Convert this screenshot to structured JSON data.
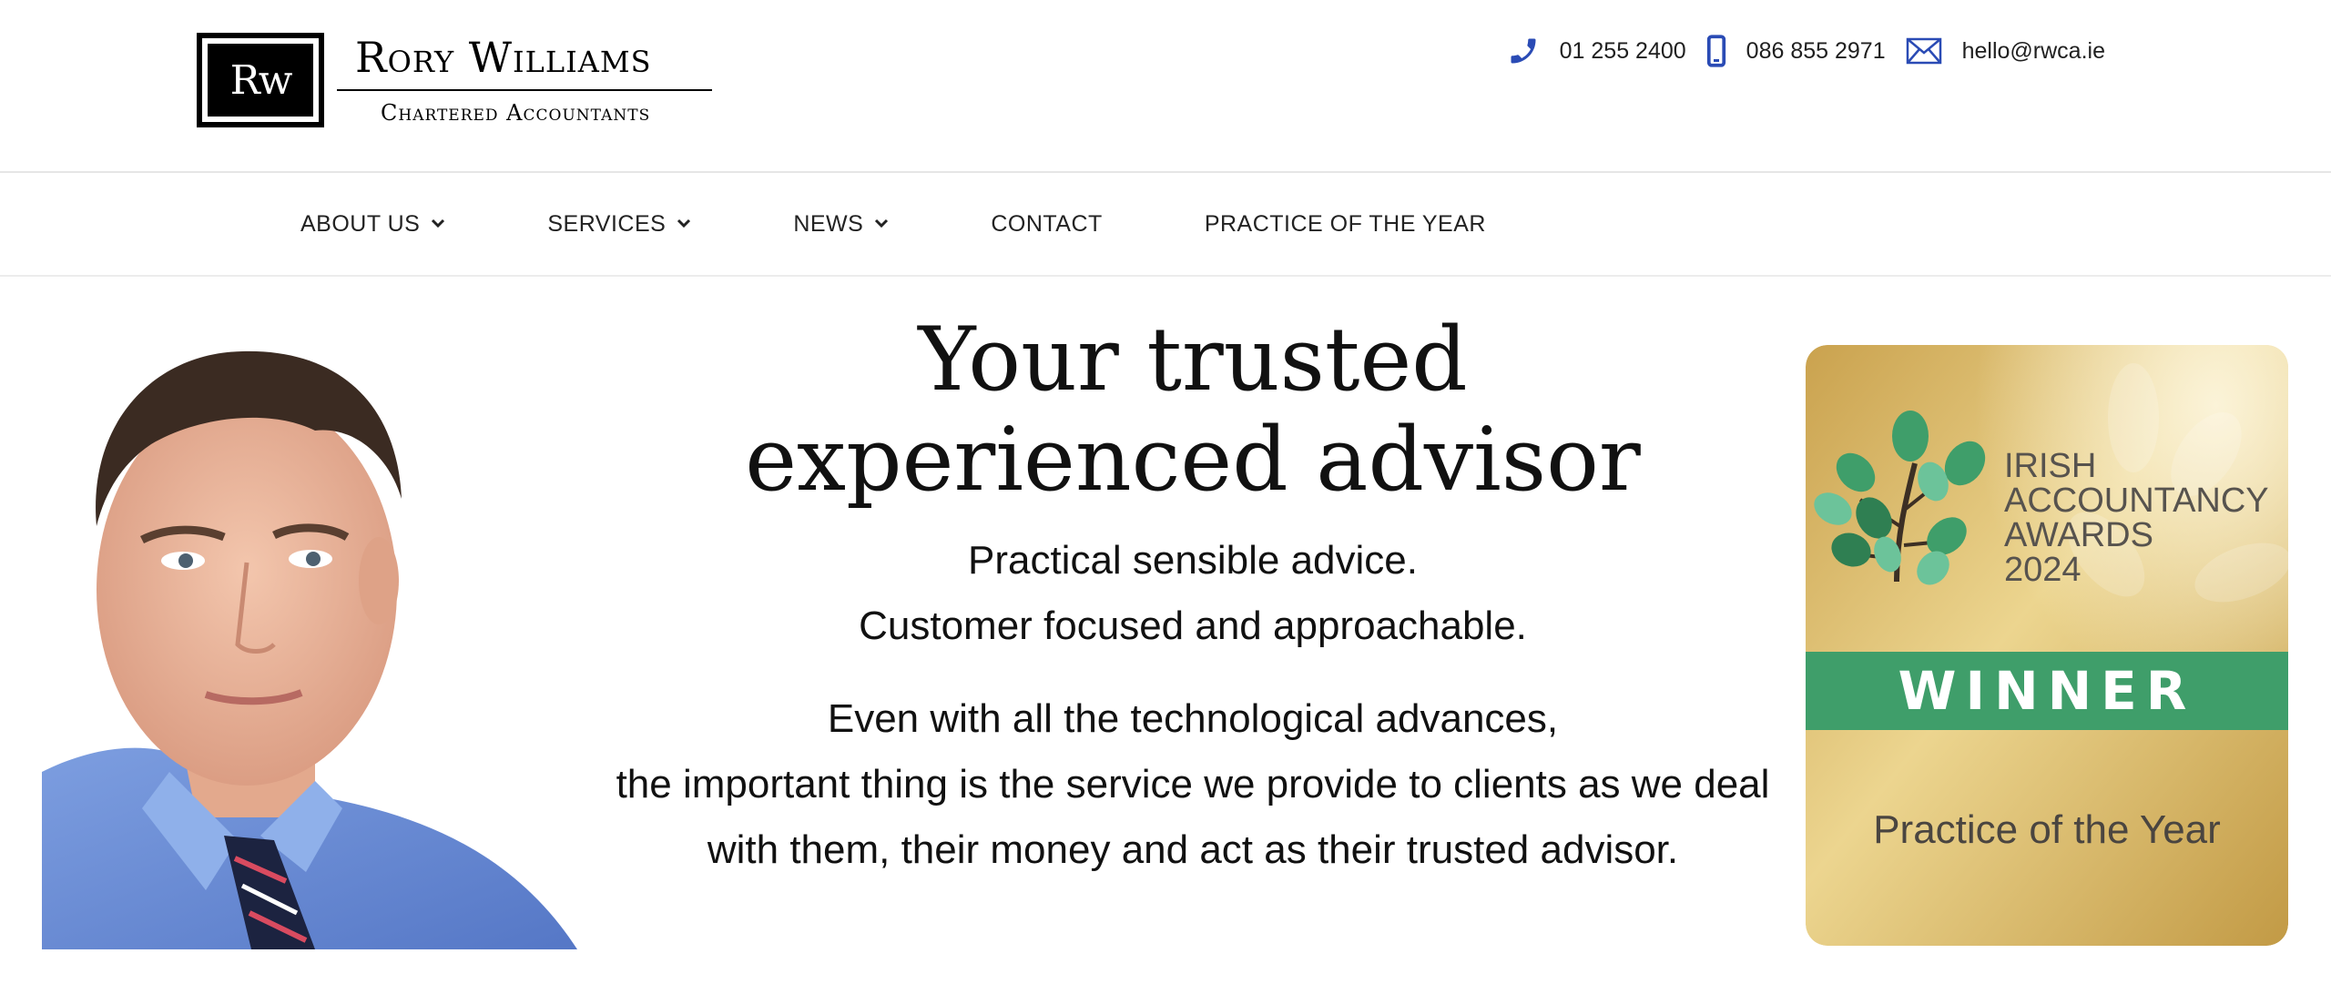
{
  "brand": {
    "monogram": "Rw",
    "name": "Rory Williams",
    "subtitle": "Chartered Accountants"
  },
  "contact": {
    "phone": "01 255 2400",
    "mobile": "086 855 2971",
    "email": "hello@rwca.ie",
    "icon_color": "#2a4bb5"
  },
  "nav": {
    "items": [
      {
        "label": "ABOUT US",
        "has_dropdown": true
      },
      {
        "label": "SERVICES",
        "has_dropdown": true
      },
      {
        "label": "NEWS",
        "has_dropdown": true
      },
      {
        "label": "CONTACT",
        "has_dropdown": false
      },
      {
        "label": "PRACTICE OF THE YEAR",
        "has_dropdown": false
      }
    ]
  },
  "hero": {
    "title_line1": "Your trusted",
    "title_line2": "experienced advisor",
    "sub_line1": "Practical sensible advice.",
    "sub_line2": "Customer focused and approachable.",
    "body_line1": "Even with all the technological advances,",
    "body_line2": "the important thing is the service we provide to clients as we deal",
    "body_line3": "with them, their money and act as their trusted advisor."
  },
  "award": {
    "line1": "IRISH",
    "line2": "ACCOUNTANCY",
    "line3": "AWARDS",
    "year": "2024",
    "banner": "WINNER",
    "category": "Practice of the Year",
    "banner_color": "#3f9e6a",
    "gold_color": "#d9b761"
  }
}
